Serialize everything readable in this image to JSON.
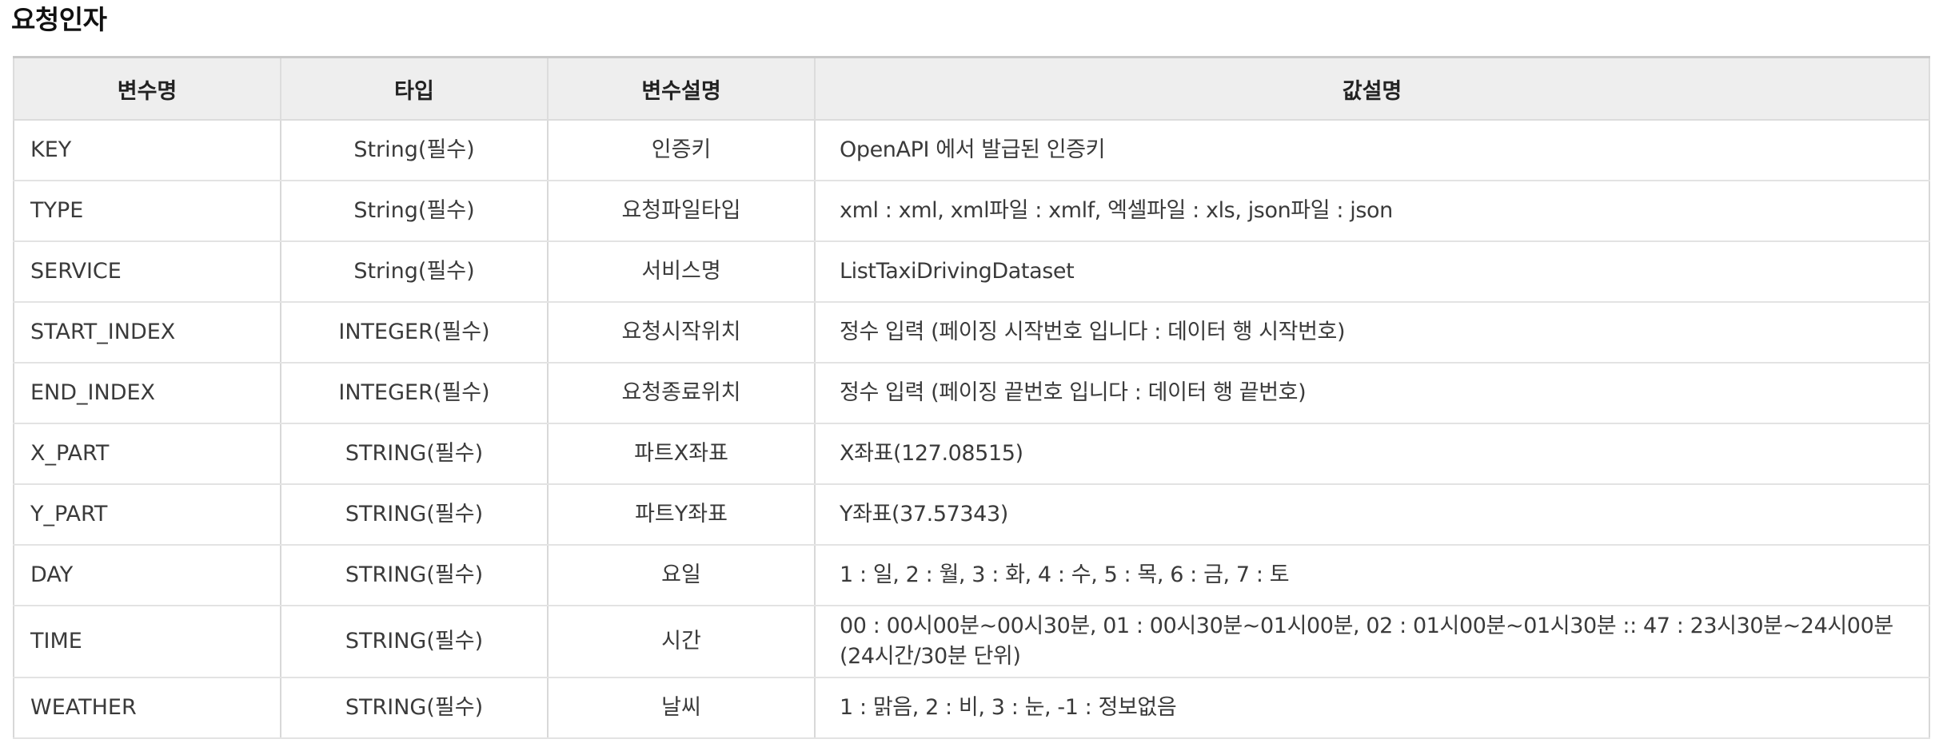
{
  "title": "요청인자",
  "table": {
    "headers": [
      "변수명",
      "타입",
      "변수설명",
      "값설명"
    ],
    "rows": [
      {
        "name": "KEY",
        "type": "String(필수)",
        "desc": "인증키",
        "value": "OpenAPI 에서 발급된 인증키"
      },
      {
        "name": "TYPE",
        "type": "String(필수)",
        "desc": "요청파일타입",
        "value": "xml : xml, xml파일 : xmlf, 엑셀파일 : xls, json파일 : json"
      },
      {
        "name": "SERVICE",
        "type": "String(필수)",
        "desc": "서비스명",
        "value": "ListTaxiDrivingDataset"
      },
      {
        "name": "START_INDEX",
        "type": "INTEGER(필수)",
        "desc": "요청시작위치",
        "value": "정수 입력 (페이징 시작번호 입니다 : 데이터 행 시작번호)"
      },
      {
        "name": "END_INDEX",
        "type": "INTEGER(필수)",
        "desc": "요청종료위치",
        "value": "정수 입력 (페이징 끝번호 입니다 : 데이터 행 끝번호)"
      },
      {
        "name": "X_PART",
        "type": "STRING(필수)",
        "desc": "파트X좌표",
        "value": "X좌표(127.08515)"
      },
      {
        "name": "Y_PART",
        "type": "STRING(필수)",
        "desc": "파트Y좌표",
        "value": "Y좌표(37.57343)"
      },
      {
        "name": "DAY",
        "type": "STRING(필수)",
        "desc": "요일",
        "value": "1 : 일, 2 : 월, 3 : 화, 4 : 수, 5 : 목, 6 : 금, 7 : 토"
      },
      {
        "name": "TIME",
        "type": "STRING(필수)",
        "desc": "시간",
        "value": "00 : 00시00분~00시30분, 01 : 00시30분~01시00분, 02 : 01시00분~01시30분 :: 47 : 23시30분~24시00분 (24시간/30분 단위)"
      },
      {
        "name": "WEATHER",
        "type": "STRING(필수)",
        "desc": "날씨",
        "value": "1 : 맑음, 2 : 비, 3 : 눈, -1 : 정보없음"
      }
    ]
  }
}
